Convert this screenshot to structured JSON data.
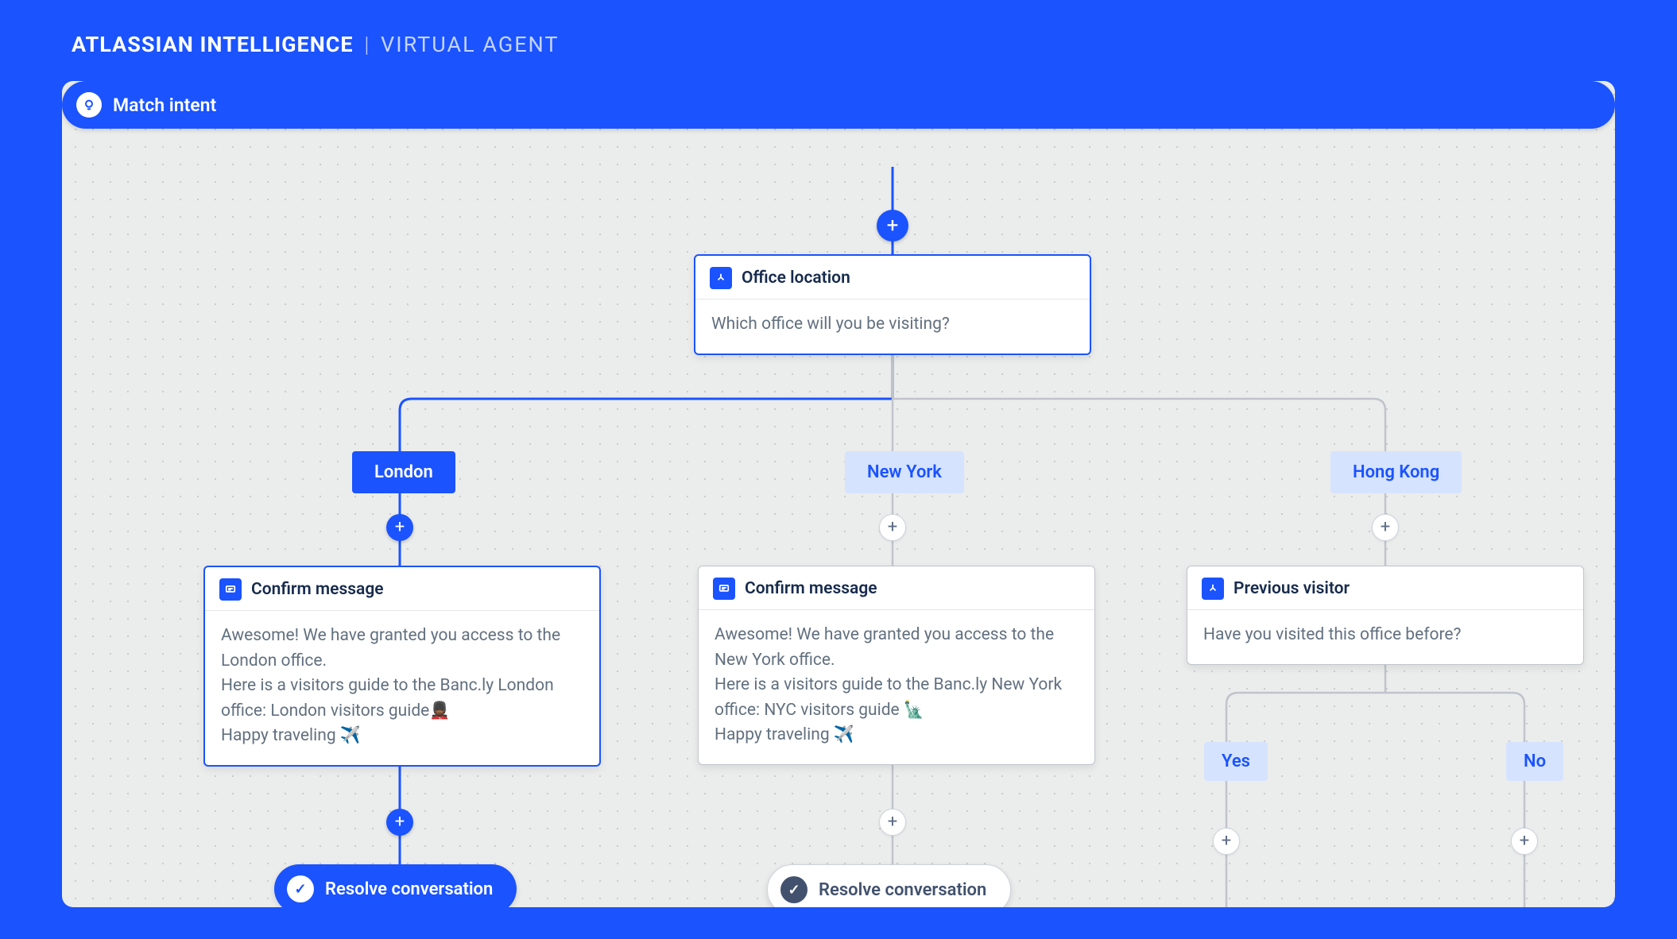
{
  "header": {
    "brand": "ATLASSIAN INTELLIGENCE",
    "section": "VIRTUAL AGENT"
  },
  "flow": {
    "start_label": "Match intent",
    "question_card": {
      "title": "Office location",
      "prompt": "Which office will you be visiting?"
    },
    "branches": {
      "london": {
        "option": "London",
        "confirm_title": "Confirm message",
        "confirm_body": "Awesome! We have granted you access to the London office.\nHere is a visitors guide to the Banc.ly London office: London visitors guide💂🏾\nHappy traveling ✈️",
        "resolve": "Resolve conversation"
      },
      "newyork": {
        "option": "New York",
        "confirm_title": "Confirm message",
        "confirm_body": "Awesome! We have granted you access to the New York office.\nHere is a visitors guide to the Banc.ly New York office: NYC visitors guide 🗽\nHappy traveling ✈️",
        "resolve": "Resolve conversation"
      },
      "hongkong": {
        "option": "Hong Kong",
        "followup_title": "Previous visitor",
        "followup_prompt": "Have you visited this office before?",
        "options": {
          "yes": "Yes",
          "no": "No"
        }
      }
    }
  }
}
